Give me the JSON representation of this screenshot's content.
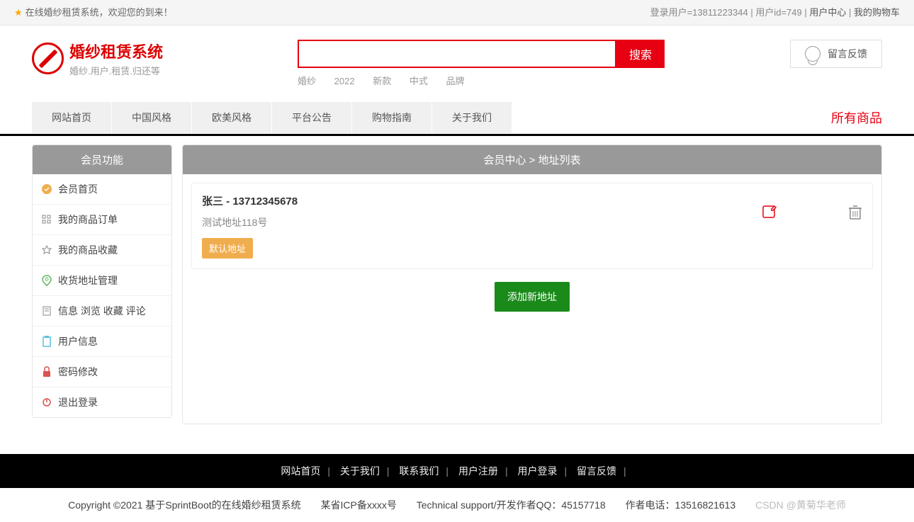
{
  "topbar": {
    "welcome": "在线婚纱租赁系统，欢迎您的到来！",
    "login_user": "登录用户=13811223344",
    "user_id": "用户id=749",
    "user_center": "用户中心",
    "my_cart": "我的购物车"
  },
  "logo": {
    "title": "婚纱租赁系统",
    "subtitle": "婚纱.用户.租赁.归还等"
  },
  "search": {
    "button": "搜索",
    "hot": [
      "婚纱",
      "2022",
      "新款",
      "中式",
      "品牌"
    ]
  },
  "feedback_label": "留言反馈",
  "nav": {
    "items": [
      "网站首页",
      "中国风格",
      "欧美风格",
      "平台公告",
      "购物指南",
      "关于我们"
    ],
    "right": "所有商品"
  },
  "sidebar": {
    "title": "会员功能",
    "items": [
      {
        "label": "会员首页"
      },
      {
        "label": "我的商品订单"
      },
      {
        "label": "我的商品收藏"
      },
      {
        "label": "收货地址管理"
      },
      {
        "label": "信息 浏览 收藏 评论"
      },
      {
        "label": "用户信息"
      },
      {
        "label": "密码修改"
      },
      {
        "label": "退出登录"
      }
    ]
  },
  "content": {
    "breadcrumb": "会员中心 > 地址列表",
    "address": {
      "name_phone": "张三 - 13712345678",
      "detail": "测试地址118号",
      "default_badge": "默认地址"
    },
    "add_button": "添加新地址"
  },
  "footer": {
    "nav": [
      "网站首页",
      "关于我们",
      "联系我们",
      "用户注册",
      "用户登录",
      "留言反馈"
    ],
    "copyright": "Copyright ©2021 基于SprintBoot的在线婚纱租赁系统",
    "icp": "某省ICP备xxxx号",
    "support": "Technical support/开发作者QQ：45157718",
    "phone": "作者电话：13516821613",
    "watermark": "CSDN @黄菊华老师"
  }
}
